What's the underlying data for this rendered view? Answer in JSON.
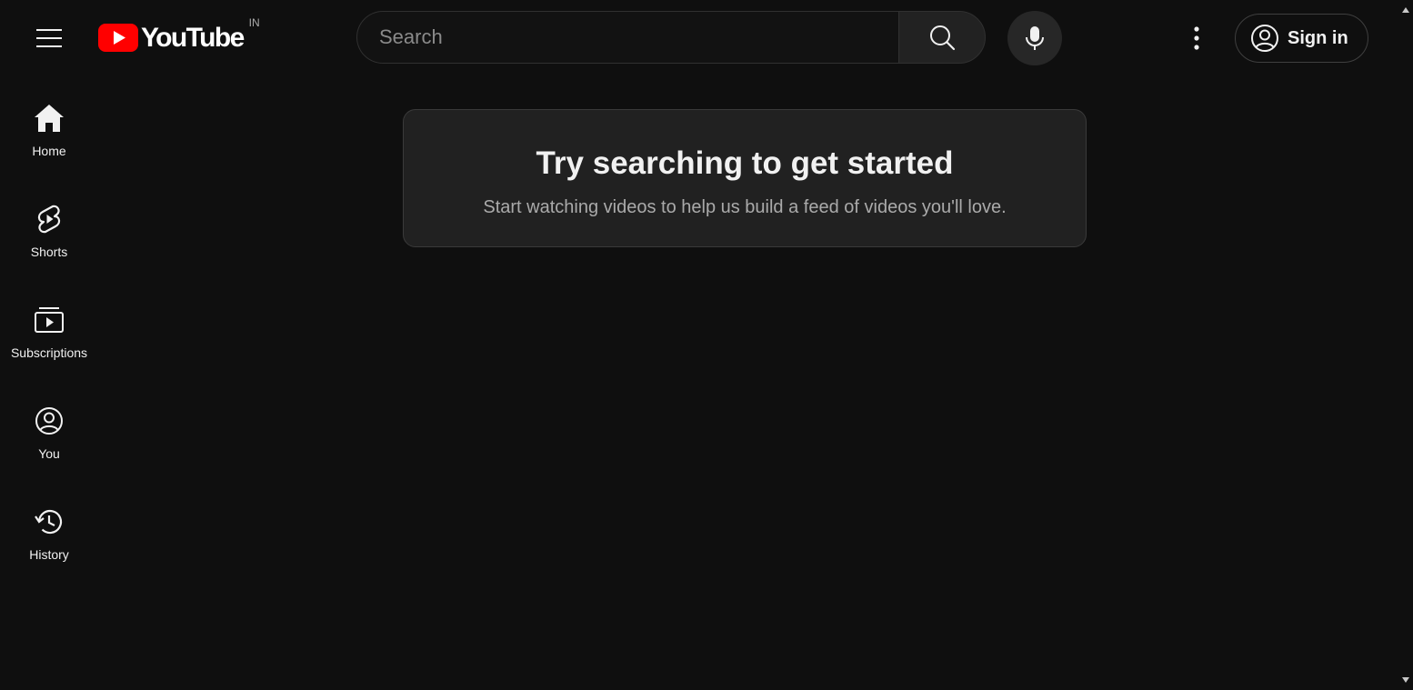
{
  "header": {
    "logo_text": "YouTube",
    "country_code": "IN",
    "brand_color": "#ff0000",
    "menu_icon": "hamburger-menu-icon",
    "search": {
      "placeholder": "Search",
      "value": "",
      "icon": "search-icon"
    },
    "voice_icon": "microphone-icon",
    "more_icon": "more-vertical-icon",
    "signin": {
      "label": "Sign in",
      "icon": "account-circle-icon"
    }
  },
  "sidebar": {
    "items": [
      {
        "label": "Home",
        "icon": "home-icon"
      },
      {
        "label": "Shorts",
        "icon": "shorts-icon"
      },
      {
        "label": "Subscriptions",
        "icon": "subscriptions-icon"
      },
      {
        "label": "You",
        "icon": "account-circle-icon"
      },
      {
        "label": "History",
        "icon": "history-icon"
      }
    ]
  },
  "main": {
    "title": "Try searching to get started",
    "subtitle": "Start watching videos to help us build a feed of videos you'll love."
  },
  "colors": {
    "background": "#0f0f0f",
    "card": "#212121",
    "text": "#f1f1f1",
    "secondary_text": "#aaaaaa"
  }
}
